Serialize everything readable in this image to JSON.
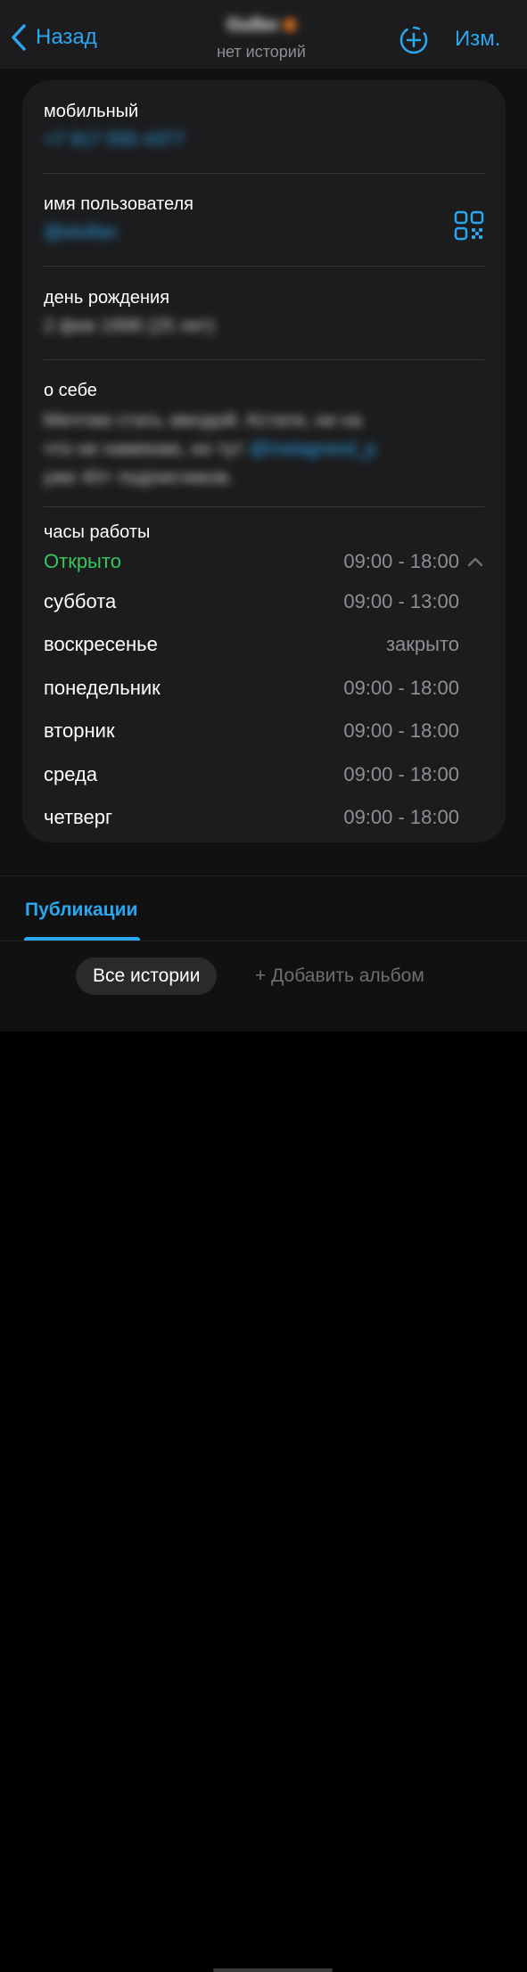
{
  "nav": {
    "back_label": "Назад",
    "title": "Gulbo",
    "subtitle": "нет историй",
    "edit_label": "Изм."
  },
  "info": {
    "mobile_label": "мобильный",
    "mobile_value": "+7 917 555 4377",
    "username_label": "имя пользователя",
    "username_value": "@elvifan",
    "birthday_label": "день рождения",
    "birthday_value": "2 фев 1998 (25 лет)",
    "about_label": "о себе",
    "about_line1": "Мечтаю стать звездой. Кстати, ни на",
    "about_line2": "что не намекаю, но тут",
    "about_mention": "@instagrand_p",
    "about_line3": "уже 40+ подписчиков."
  },
  "hours": {
    "label": "часы работы",
    "status": "Открыто",
    "today_time": "09:00 - 18:00",
    "days": [
      {
        "name": "суббота",
        "time": "09:00 - 13:00"
      },
      {
        "name": "воскресенье",
        "time": "закрыто"
      },
      {
        "name": "понедельник",
        "time": "09:00 - 18:00"
      },
      {
        "name": "вторник",
        "time": "09:00 - 18:00"
      },
      {
        "name": "среда",
        "time": "09:00 - 18:00"
      },
      {
        "name": "четверг",
        "time": "09:00 - 18:00"
      }
    ]
  },
  "tabs": {
    "publications": "Публикации"
  },
  "chips": {
    "all_stories": "Все истории",
    "add_album": "+ Добавить альбом"
  },
  "colors": {
    "accent": "#2aa7f0",
    "open_green": "#35c759",
    "card_bg": "#1c1c1e",
    "secondary_text": "#8e8e93"
  },
  "icons": {
    "back": "chevron-left-icon",
    "story_add": "dashed-circle-plus-icon",
    "qr": "qr-code-icon",
    "collapse": "chevron-up-icon"
  }
}
